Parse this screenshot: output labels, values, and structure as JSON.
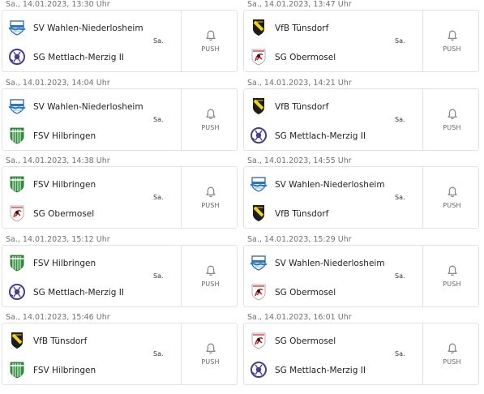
{
  "matches": [
    {
      "date": "Sa., 14.01.2023, 13:30 Uhr",
      "home": "SV Wahlen-Niederlosheim",
      "away": "SG Mettlach-Merzig II",
      "home_logo": "sv-wahlen-logo",
      "away_logo": "sg-mettlach-logo",
      "day": "Sa.",
      "push": "PUSH"
    },
    {
      "date": "Sa., 14.01.2023, 13:47 Uhr",
      "home": "VfB Tünsdorf",
      "away": "SG Obermosel",
      "home_logo": "vfb-tuensdorf-logo",
      "away_logo": "sg-obermosel-logo",
      "day": "Sa.",
      "push": "PUSH"
    },
    {
      "date": "Sa., 14.01.2023, 14:04 Uhr",
      "home": "SV Wahlen-Niederlosheim",
      "away": "FSV Hilbringen",
      "home_logo": "sv-wahlen-logo",
      "away_logo": "fsv-hilbringen-logo",
      "day": "Sa.",
      "push": "PUSH"
    },
    {
      "date": "Sa., 14.01.2023, 14:21 Uhr",
      "home": "VfB Tünsdorf",
      "away": "SG Mettlach-Merzig II",
      "home_logo": "vfb-tuensdorf-logo",
      "away_logo": "sg-mettlach-logo",
      "day": "Sa.",
      "push": "PUSH"
    },
    {
      "date": "Sa., 14.01.2023, 14:38 Uhr",
      "home": "FSV Hilbringen",
      "away": "SG Obermosel",
      "home_logo": "fsv-hilbringen-logo",
      "away_logo": "sg-obermosel-logo",
      "day": "Sa.",
      "push": "PUSH"
    },
    {
      "date": "Sa., 14.01.2023, 14:55 Uhr",
      "home": "SV Wahlen-Niederlosheim",
      "away": "VfB Tünsdorf",
      "home_logo": "sv-wahlen-logo",
      "away_logo": "vfb-tuensdorf-logo",
      "day": "Sa.",
      "push": "PUSH"
    },
    {
      "date": "Sa., 14.01.2023, 15:12 Uhr",
      "home": "FSV Hilbringen",
      "away": "SG Mettlach-Merzig II",
      "home_logo": "fsv-hilbringen-logo",
      "away_logo": "sg-mettlach-logo",
      "day": "Sa.",
      "push": "PUSH"
    },
    {
      "date": "Sa., 14.01.2023, 15:29 Uhr",
      "home": "SV Wahlen-Niederlosheim",
      "away": "SG Obermosel",
      "home_logo": "sv-wahlen-logo",
      "away_logo": "sg-obermosel-logo",
      "day": "Sa.",
      "push": "PUSH"
    },
    {
      "date": "Sa., 14.01.2023, 15:46 Uhr",
      "home": "VfB Tünsdorf",
      "away": "FSV Hilbringen",
      "home_logo": "vfb-tuensdorf-logo",
      "away_logo": "fsv-hilbringen-logo",
      "day": "Sa.",
      "push": "PUSH"
    },
    {
      "date": "Sa., 14.01.2023, 16:01 Uhr",
      "home": "SG Obermosel",
      "away": "SG Mettlach-Merzig II",
      "home_logo": "sg-obermosel-logo",
      "away_logo": "sg-mettlach-logo",
      "day": "Sa.",
      "push": "PUSH"
    }
  ],
  "colors": {
    "border": "#e2e2e2",
    "date_text": "#707070",
    "team_text": "#222222",
    "icon_gray": "#8a8a8a",
    "hilbringen_green": "#2f8f3a",
    "tuensdorf_yellow": "#f2d21b",
    "wahlen_blue": "#2a78c2",
    "mettlach_purple": "#4b3b8f",
    "obermosel_red": "#c62828"
  }
}
